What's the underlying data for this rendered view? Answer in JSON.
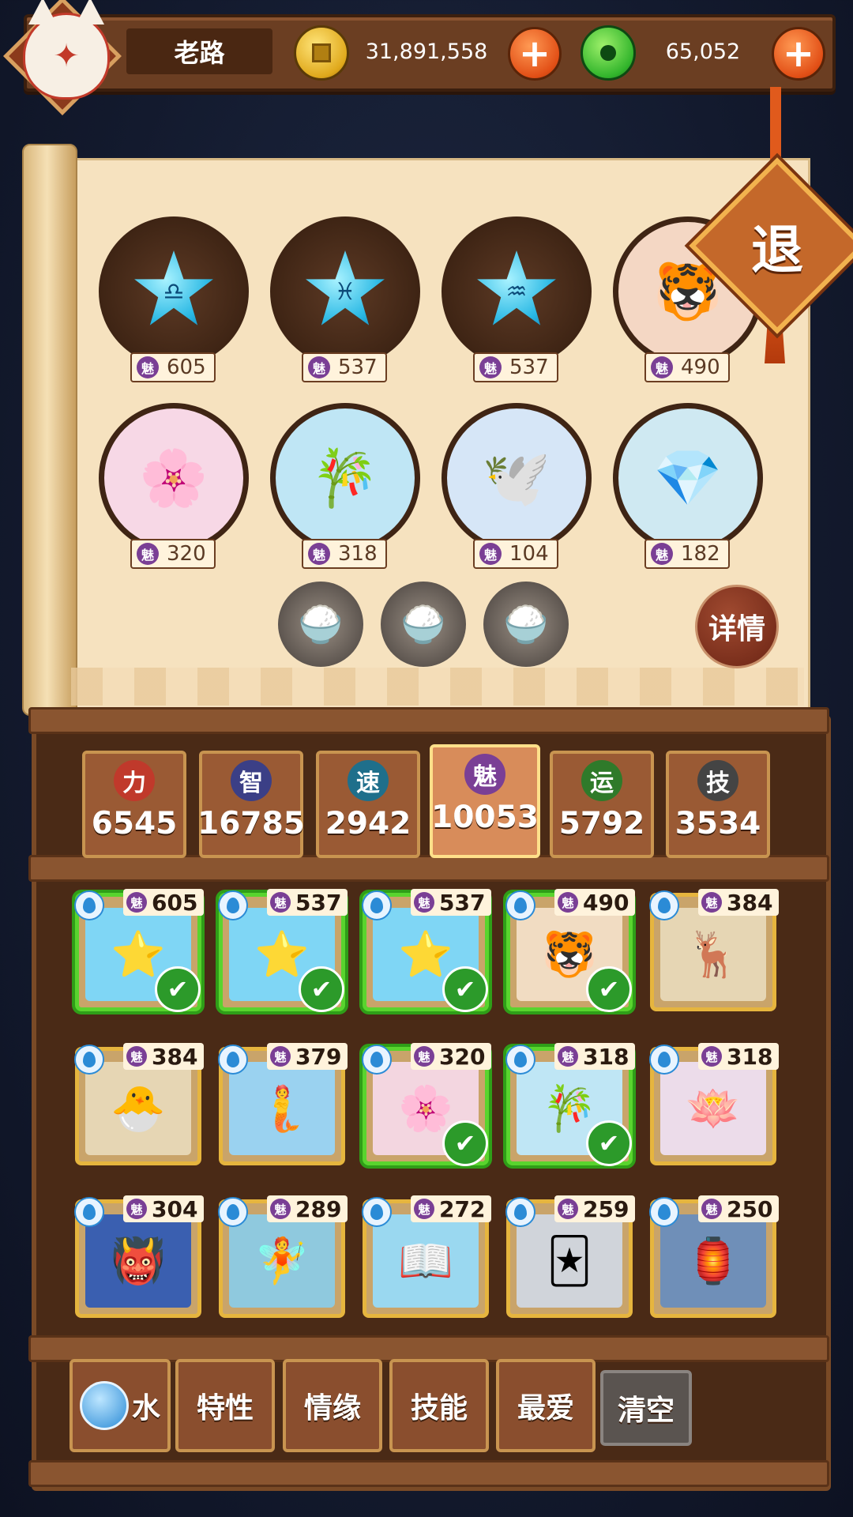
{
  "player": {
    "name": "老路",
    "gold": "31,891,558",
    "jade": "65,052",
    "avatar_icon": "fox-mask-icon"
  },
  "board": {
    "slots": [
      {
        "kind": "star",
        "symbol": "♎",
        "charm": "605"
      },
      {
        "kind": "star",
        "symbol": "♓",
        "charm": "537"
      },
      {
        "kind": "star",
        "symbol": "♒",
        "charm": "537"
      },
      {
        "kind": "hero",
        "emoji": "🐯",
        "bg": "#f4d7c4",
        "charm": "490"
      },
      {
        "kind": "hero",
        "emoji": "🌸",
        "bg": "#f7d8e6",
        "charm": "320"
      },
      {
        "kind": "hero",
        "emoji": "🎋",
        "bg": "#bfe6f5",
        "charm": "318"
      },
      {
        "kind": "hero",
        "emoji": "🕊️",
        "bg": "#d6e6f7",
        "charm": "104"
      },
      {
        "kind": "hero",
        "emoji": "💎",
        "bg": "#cfe9f2",
        "charm": "182"
      }
    ],
    "charm_label": "魅",
    "bowl_icon": "rice-bowl-icon",
    "details_label": "详情",
    "exit_label": "退"
  },
  "stats": [
    {
      "label": "力",
      "value": "6545",
      "color": "#c0392b"
    },
    {
      "label": "智",
      "value": "16785",
      "color": "#3b3f86"
    },
    {
      "label": "速",
      "value": "2942",
      "color": "#1f6f8b"
    },
    {
      "label": "魅",
      "value": "10053",
      "color": "#7a3f95"
    },
    {
      "label": "运",
      "value": "5792",
      "color": "#2f7a2a"
    },
    {
      "label": "技",
      "value": "3534",
      "color": "#444444"
    }
  ],
  "active_stat": "魅",
  "cards": [
    {
      "charm": "605",
      "emoji": "⭐",
      "bg": "#7fd6f5",
      "selected": true
    },
    {
      "charm": "537",
      "emoji": "⭐",
      "bg": "#7fd6f5",
      "selected": true
    },
    {
      "charm": "537",
      "emoji": "⭐",
      "bg": "#7fd6f5",
      "selected": true
    },
    {
      "charm": "490",
      "emoji": "🐯",
      "bg": "#f1dcc2",
      "selected": true
    },
    {
      "charm": "384",
      "emoji": "🦌",
      "bg": "#e6d6b4",
      "selected": false
    },
    {
      "charm": "384",
      "emoji": "🐣",
      "bg": "#e6d6b4",
      "selected": false
    },
    {
      "charm": "379",
      "emoji": "🧜",
      "bg": "#9ad2f0",
      "selected": false
    },
    {
      "charm": "320",
      "emoji": "🌸",
      "bg": "#f3d6e0",
      "selected": true
    },
    {
      "charm": "318",
      "emoji": "🎋",
      "bg": "#bfe6f5",
      "selected": true
    },
    {
      "charm": "318",
      "emoji": "🪷",
      "bg": "#ecdcea",
      "selected": false
    },
    {
      "charm": "304",
      "emoji": "👹",
      "bg": "#3a5fb0",
      "selected": false
    },
    {
      "charm": "289",
      "emoji": "🧚",
      "bg": "#8fc9de",
      "selected": false
    },
    {
      "charm": "272",
      "emoji": "📖",
      "bg": "#9ad8f0",
      "selected": false
    },
    {
      "charm": "259",
      "emoji": "🃏",
      "bg": "#d0d4da",
      "selected": false
    },
    {
      "charm": "250",
      "emoji": "🏮",
      "bg": "#6f8fb8",
      "selected": false
    }
  ],
  "filters": {
    "water": "水",
    "trait": "特性",
    "bond": "情缘",
    "skill": "技能",
    "favorite": "最爱",
    "clear": "清空"
  }
}
